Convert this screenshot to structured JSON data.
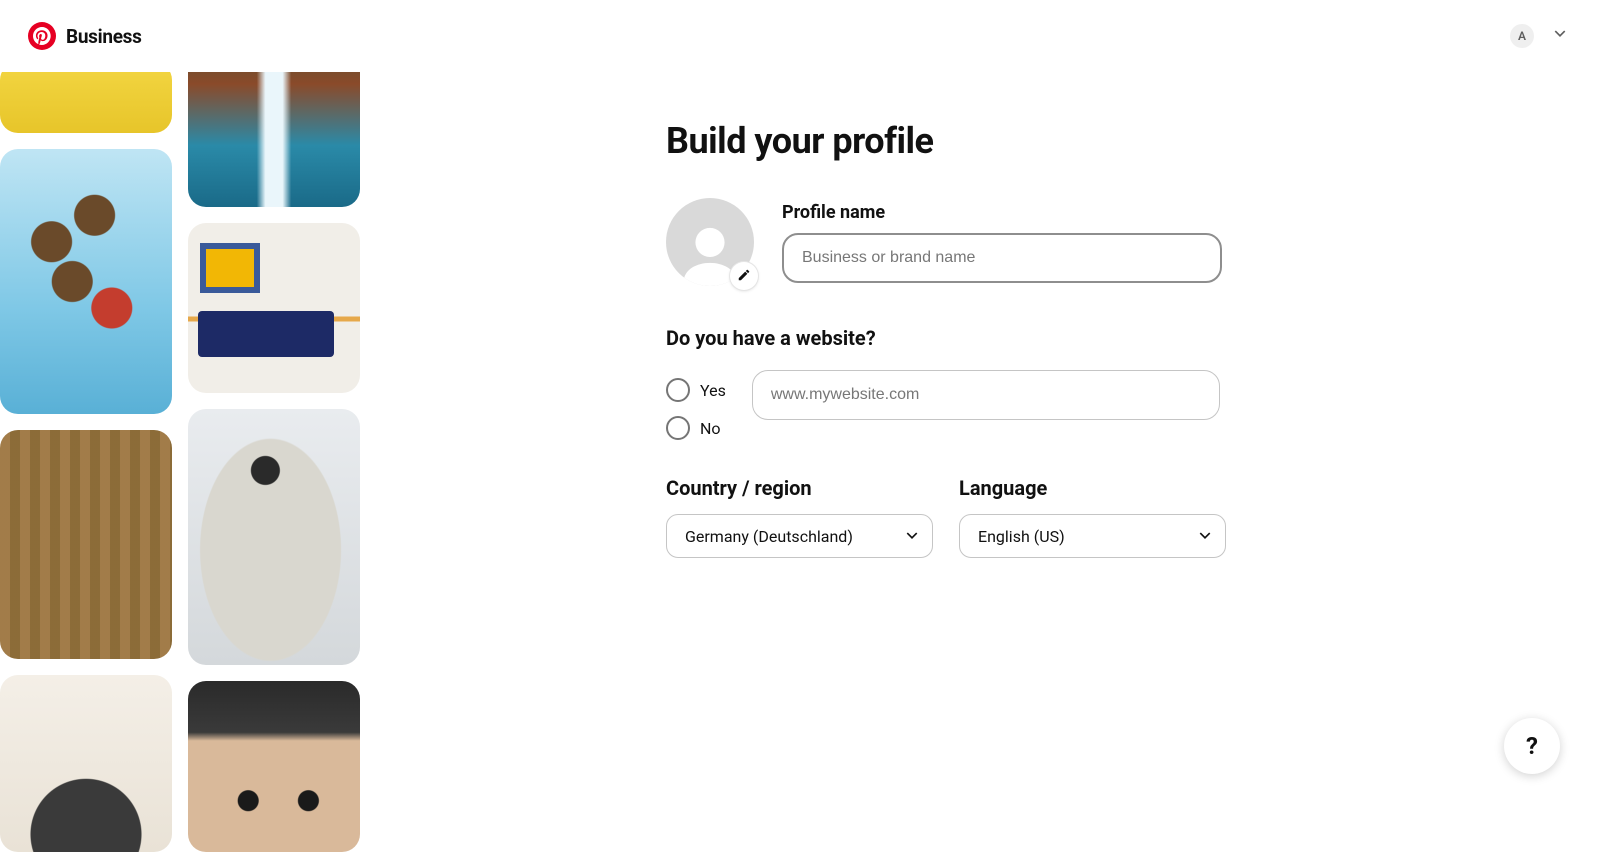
{
  "header": {
    "brand": "Business",
    "avatar_initial": "A"
  },
  "main": {
    "title": "Build your profile",
    "profile_name_label": "Profile name",
    "profile_name_placeholder": "Business or brand name",
    "profile_name_value": "",
    "website_question": "Do you have a website?",
    "website_yes": "Yes",
    "website_no": "No",
    "website_placeholder": "www.mywebsite.com",
    "website_value": "",
    "country_label": "Country / region",
    "country_value": "Germany (Deutschland)",
    "language_label": "Language",
    "language_value": "English (US)"
  },
  "help": {
    "label": "?"
  }
}
